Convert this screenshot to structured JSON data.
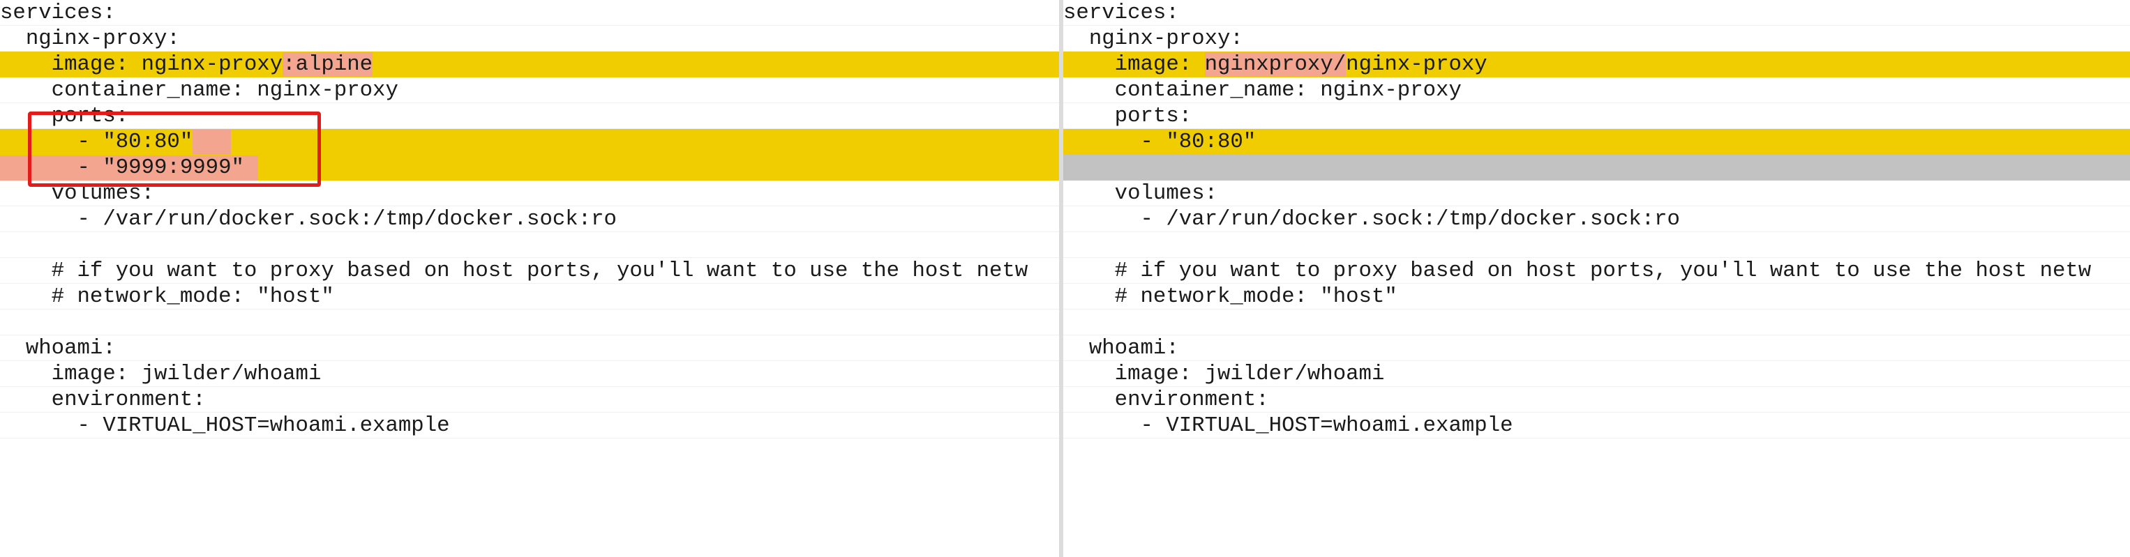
{
  "left": {
    "lines": [
      {
        "text": "services:"
      },
      {
        "text": "  nginx-proxy:"
      },
      {
        "text": "    image: nginx-proxy",
        "hl": ":alpine"
      },
      {
        "text": "    container_name: nginx-proxy"
      },
      {
        "text": "    ports:"
      },
      {
        "text": "      - \"80:80\""
      },
      {
        "text": "      - \"9999:9999\""
      },
      {
        "text": "    volumes:"
      },
      {
        "text": "      - /var/run/docker.sock:/tmp/docker.sock:ro"
      },
      {
        "text": ""
      },
      {
        "text": "    # if you want to proxy based on host ports, you'll want to use the host netw"
      },
      {
        "text": "    # network_mode: \"host\""
      },
      {
        "text": ""
      },
      {
        "text": "  whoami:"
      },
      {
        "text": "    image: jwilder/whoami"
      },
      {
        "text": "    environment:"
      },
      {
        "text": "      - VIRTUAL_HOST=whoami.example"
      }
    ]
  },
  "right": {
    "lines": [
      {
        "text": "services:"
      },
      {
        "text": "  nginx-proxy:"
      },
      {
        "pre": "    image: ",
        "hl": "nginxproxy/",
        "post": "nginx-proxy"
      },
      {
        "text": "    container_name: nginx-proxy"
      },
      {
        "text": "    ports:"
      },
      {
        "text": "      - \"80:80\""
      },
      {
        "text": ""
      },
      {
        "text": "    volumes:"
      },
      {
        "text": "      - /var/run/docker.sock:/tmp/docker.sock:ro"
      },
      {
        "text": ""
      },
      {
        "text": "    # if you want to proxy based on host ports, you'll want to use the host netw"
      },
      {
        "text": "    # network_mode: \"host\""
      },
      {
        "text": ""
      },
      {
        "text": "  whoami:"
      },
      {
        "text": "    image: jwilder/whoami"
      },
      {
        "text": "    environment:"
      },
      {
        "text": "      - VIRTUAL_HOST=whoami.example"
      }
    ]
  },
  "colors": {
    "changed_line": "#f0cd00",
    "inline_change": "#f3a58f",
    "placeholder_line": "#c2c2c2",
    "annotation_box": "#e31b1b"
  }
}
